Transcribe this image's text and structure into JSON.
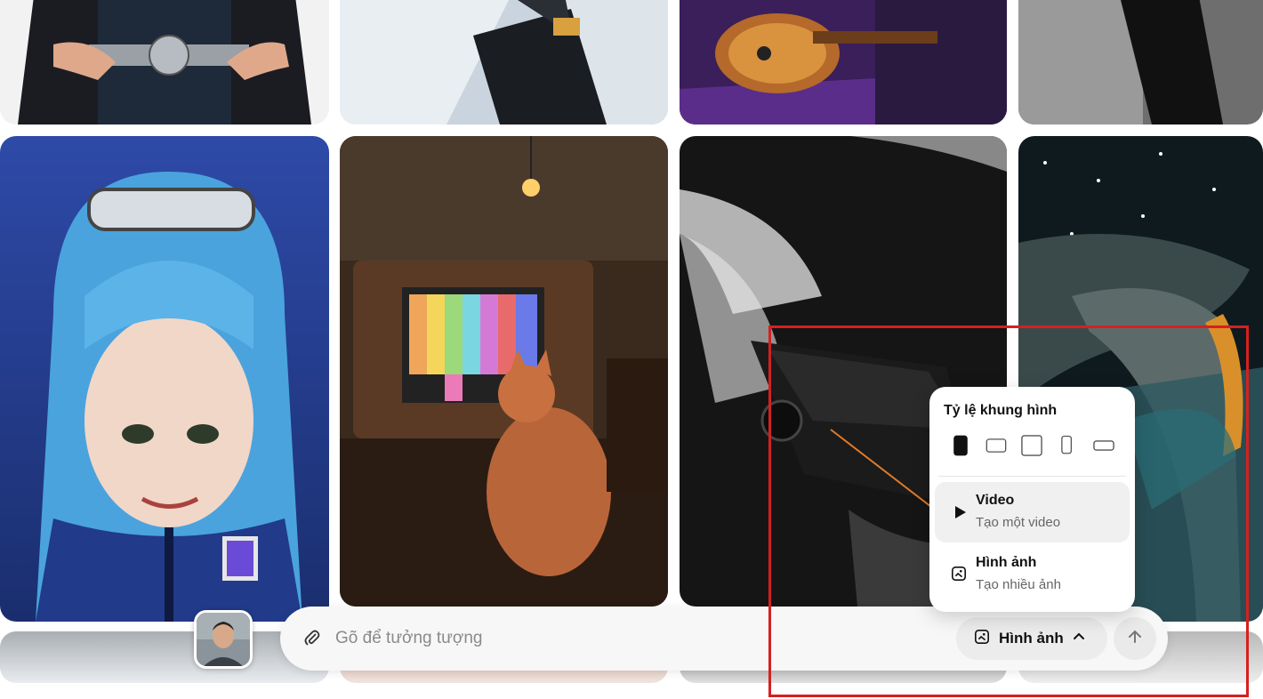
{
  "prompt": {
    "placeholder": "Gõ để tưởng tượng",
    "value": "",
    "mode_label": "Hình ảnh"
  },
  "dropdown": {
    "title": "Tỷ lệ khung hình",
    "ratios": [
      "ratio-9-16",
      "ratio-16-9",
      "ratio-1-1",
      "ratio-2-3",
      "ratio-3-2"
    ],
    "items": [
      {
        "title": "Video",
        "subtitle": "Tạo một video",
        "icon": "play-icon",
        "active": true
      },
      {
        "title": "Hình ảnh",
        "subtitle": "Tạo nhiều ảnh",
        "icon": "image-icon",
        "active": false
      }
    ]
  },
  "highlight_color": "#d62020"
}
